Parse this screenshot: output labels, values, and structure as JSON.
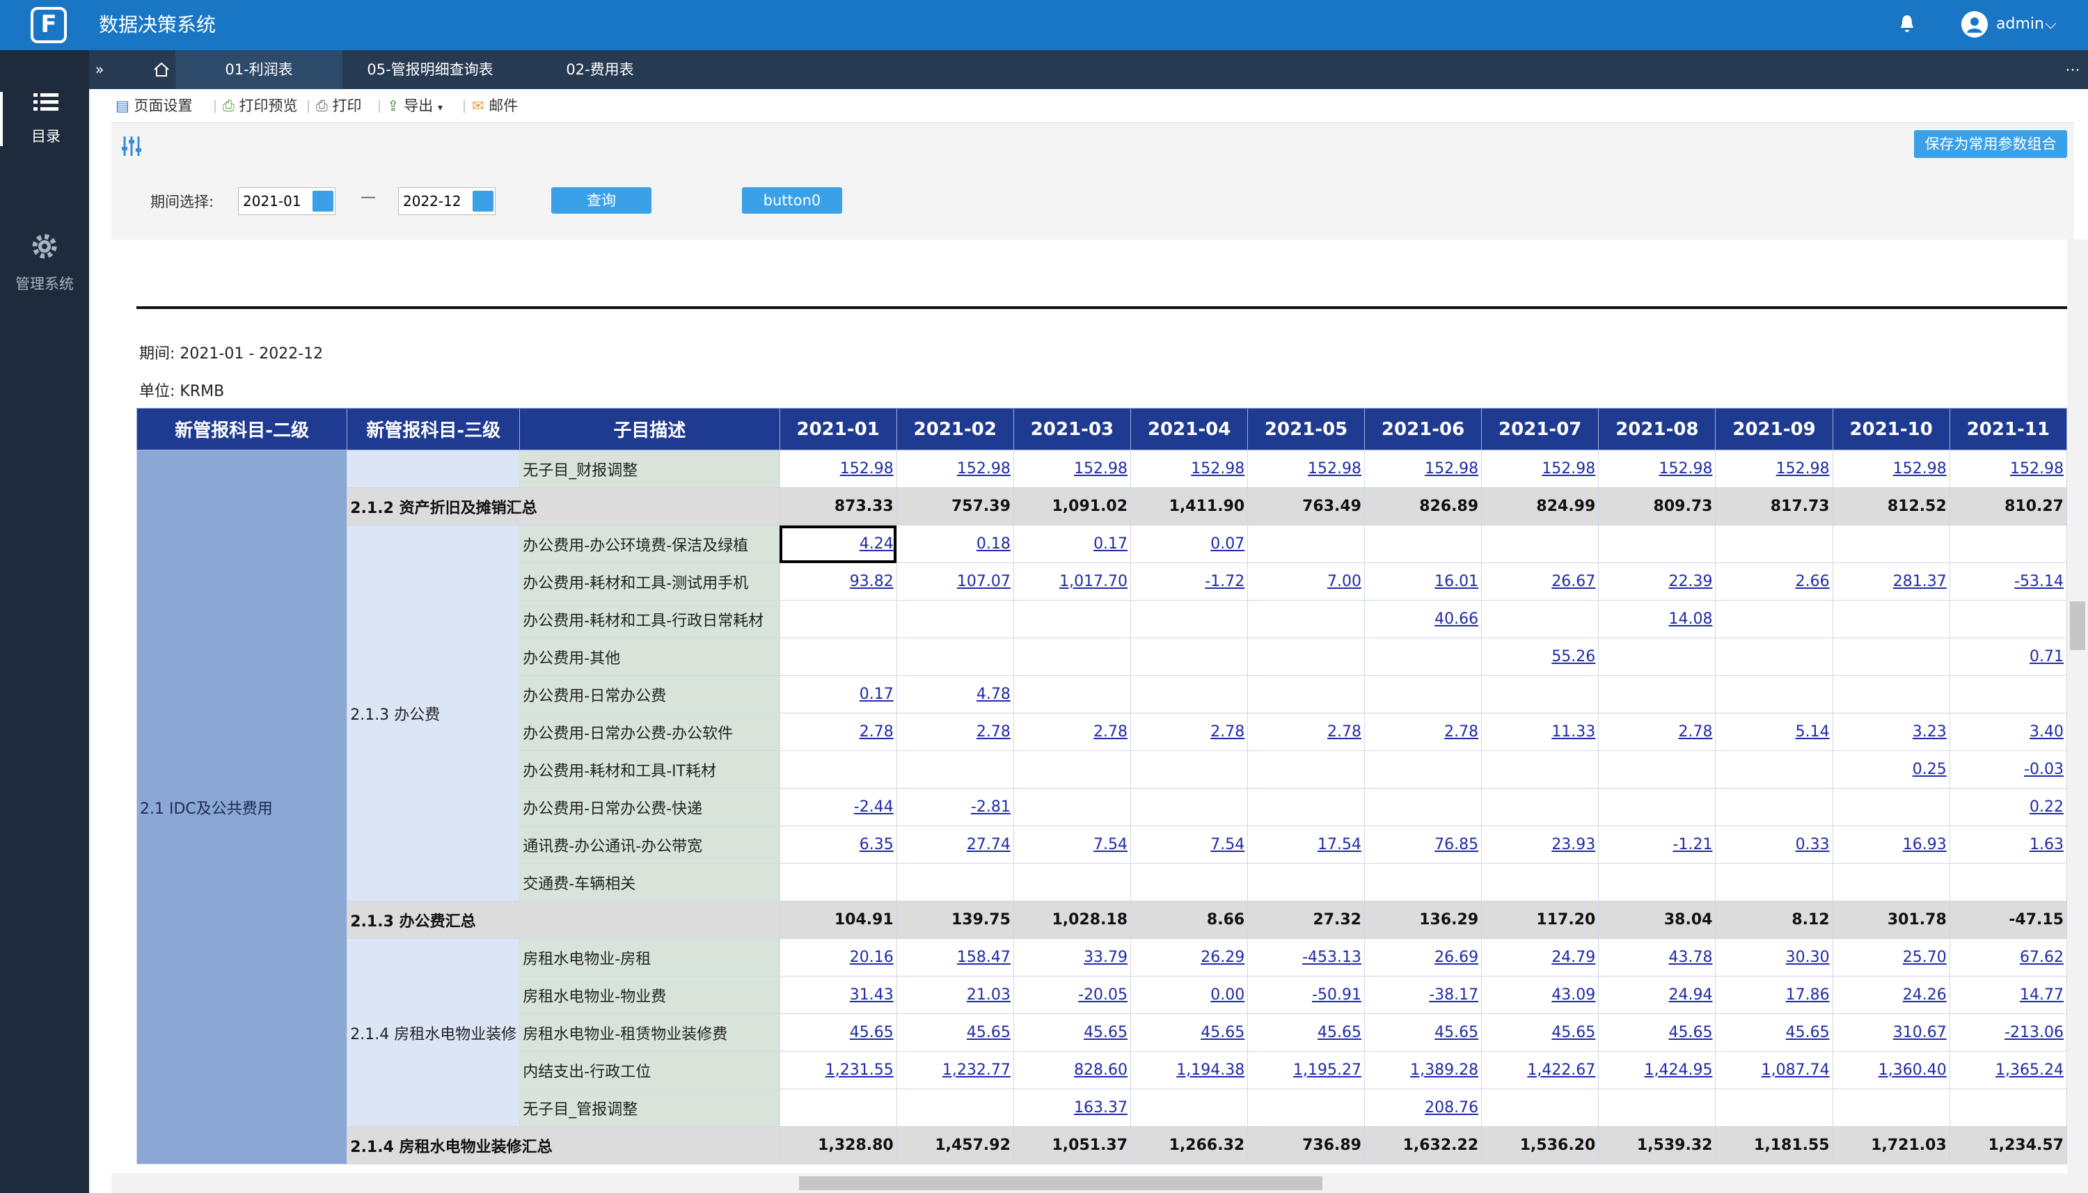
{
  "app": {
    "title": "数据决策系统",
    "logo": "F"
  },
  "user": {
    "name": "admin"
  },
  "sidebar": [
    {
      "label": "目录"
    },
    {
      "label": "管理系统"
    }
  ],
  "tabs": [
    {
      "label": "01-利润表"
    },
    {
      "label": "05-管报明细查询表"
    },
    {
      "label": "02-费用表"
    }
  ],
  "toolbar": {
    "page_setup": "页面设置",
    "print_preview": "打印预览",
    "print": "打印",
    "export": "导出",
    "email": "邮件"
  },
  "params": {
    "period_label": "期间选择:",
    "start": "2021-01",
    "end": "2022-12",
    "dash": "—",
    "query": "查询",
    "button0": "button0",
    "save": "保存为常用参数组合"
  },
  "report": {
    "period": "期间:  2021-01 - 2022-12",
    "unit": "单位:  KRMB",
    "headers": [
      "新管报科目-二级",
      "新管报科目-三级",
      "子目描述",
      "2021-01",
      "2021-02",
      "2021-03",
      "2021-04",
      "2021-05",
      "2021-06",
      "2021-07",
      "2021-08",
      "2021-09",
      "2021-10",
      "2021-11"
    ],
    "level2": "2.1 IDC及公共费用",
    "group3_office": "2.1.3 办公费",
    "group3_rent": "2.1.4 房租水电物业装修",
    "rows": [
      {
        "desc": "无子目_财报调整",
        "v": [
          "152.98",
          "152.98",
          "152.98",
          "152.98",
          "152.98",
          "152.98",
          "152.98",
          "152.98",
          "152.98",
          "152.98",
          "152.98"
        ]
      },
      {
        "sum": "2.1.2 资产折旧及摊销汇总",
        "v": [
          "873.33",
          "757.39",
          "1,091.02",
          "1,411.90",
          "763.49",
          "826.89",
          "824.99",
          "809.73",
          "817.73",
          "812.52",
          "810.27"
        ]
      },
      {
        "desc": "办公费用-办公环境费-保洁及绿植",
        "v": [
          "4.24",
          "0.18",
          "0.17",
          "0.07",
          "",
          "",
          "",
          "",
          "",
          "",
          ""
        ]
      },
      {
        "desc": "办公费用-耗材和工具-测试用手机",
        "v": [
          "93.82",
          "107.07",
          "1,017.70",
          "-1.72",
          "7.00",
          "16.01",
          "26.67",
          "22.39",
          "2.66",
          "281.37",
          "-53.14"
        ]
      },
      {
        "desc": "办公费用-耗材和工具-行政日常耗材",
        "v": [
          "",
          "",
          "",
          "",
          "",
          "40.66",
          "",
          "14.08",
          "",
          "",
          ""
        ]
      },
      {
        "desc": "办公费用-其他",
        "v": [
          "",
          "",
          "",
          "",
          "",
          "",
          "55.26",
          "",
          "",
          "",
          "0.71"
        ]
      },
      {
        "desc": "办公费用-日常办公费",
        "v": [
          "0.17",
          "4.78",
          "",
          "",
          "",
          "",
          "",
          "",
          "",
          "",
          ""
        ]
      },
      {
        "desc": "办公费用-日常办公费-办公软件",
        "v": [
          "2.78",
          "2.78",
          "2.78",
          "2.78",
          "2.78",
          "2.78",
          "11.33",
          "2.78",
          "5.14",
          "3.23",
          "3.40"
        ]
      },
      {
        "desc": "办公费用-耗材和工具-IT耗材",
        "v": [
          "",
          "",
          "",
          "",
          "",
          "",
          "",
          "",
          "",
          "0.25",
          "-0.03"
        ]
      },
      {
        "desc": "办公费用-日常办公费-快递",
        "v": [
          "-2.44",
          "-2.81",
          "",
          "",
          "",
          "",
          "",
          "",
          "",
          "",
          "0.22"
        ]
      },
      {
        "desc": "通讯费-办公通讯-办公带宽",
        "v": [
          "6.35",
          "27.74",
          "7.54",
          "7.54",
          "17.54",
          "76.85",
          "23.93",
          "-1.21",
          "0.33",
          "16.93",
          "1.63"
        ]
      },
      {
        "desc": "交通费-车辆相关",
        "v": [
          "",
          "",
          "",
          "",
          "",
          "",
          "",
          "",
          "",
          "",
          ""
        ]
      },
      {
        "sum": "2.1.3 办公费汇总",
        "v": [
          "104.91",
          "139.75",
          "1,028.18",
          "8.66",
          "27.32",
          "136.29",
          "117.20",
          "38.04",
          "8.12",
          "301.78",
          "-47.15"
        ]
      },
      {
        "desc": "房租水电物业-房租",
        "v": [
          "20.16",
          "158.47",
          "33.79",
          "26.29",
          "-453.13",
          "26.69",
          "24.79",
          "43.78",
          "30.30",
          "25.70",
          "67.62"
        ]
      },
      {
        "desc": "房租水电物业-物业费",
        "v": [
          "31.43",
          "21.03",
          "-20.05",
          "0.00",
          "-50.91",
          "-38.17",
          "43.09",
          "24.94",
          "17.86",
          "24.26",
          "14.77"
        ]
      },
      {
        "desc": "房租水电物业-租赁物业装修费",
        "v": [
          "45.65",
          "45.65",
          "45.65",
          "45.65",
          "45.65",
          "45.65",
          "45.65",
          "45.65",
          "45.65",
          "310.67",
          "-213.06"
        ]
      },
      {
        "desc": "内结支出-行政工位",
        "v": [
          "1,231.55",
          "1,232.77",
          "828.60",
          "1,194.38",
          "1,195.27",
          "1,389.28",
          "1,422.67",
          "1,424.95",
          "1,087.74",
          "1,360.40",
          "1,365.24"
        ]
      },
      {
        "desc": "无子目_管报调整",
        "v": [
          "",
          "",
          "163.37",
          "",
          "",
          "208.76",
          "",
          "",
          "",
          "",
          ""
        ]
      },
      {
        "sum": "2.1.4 房租水电物业装修汇总",
        "v": [
          "1,328.80",
          "1,457.92",
          "1,051.37",
          "1,266.32",
          "736.89",
          "1,632.22",
          "1,536.20",
          "1,539.32",
          "1,181.55",
          "1,721.03",
          "1,234.57"
        ]
      }
    ]
  }
}
